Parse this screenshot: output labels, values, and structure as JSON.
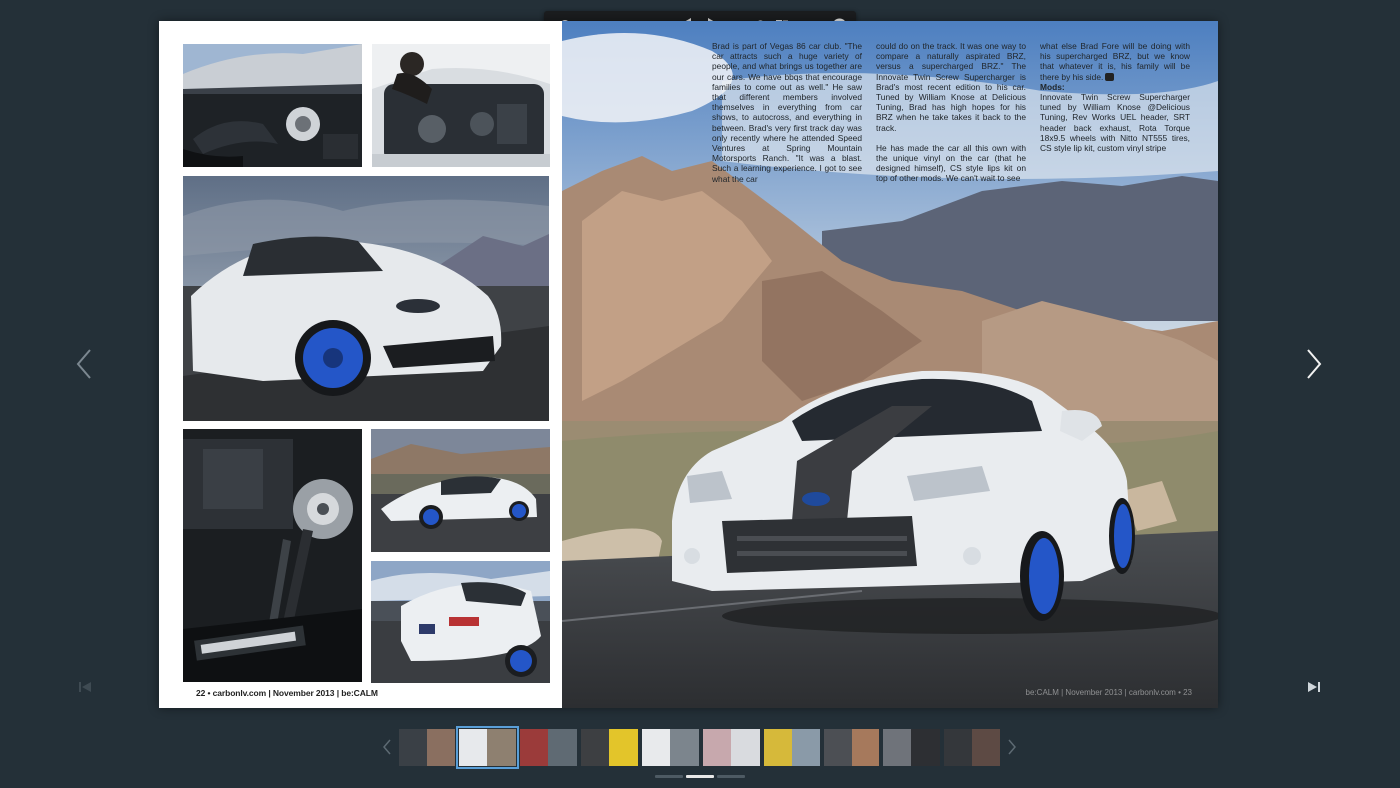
{
  "toolbar": {
    "zoom_level": 0.15,
    "icons": [
      "zoom-slider",
      "two-page-view-icon",
      "previous-page-icon",
      "next-page-icon",
      "search-icon",
      "bookmark-icon",
      "share-icon",
      "close-icon"
    ]
  },
  "left_page": {
    "footer": "22 • carbonlv.com | November 2013 | be:CALM"
  },
  "right_page": {
    "footer": "be:CALM | November 2013 | carbonlv.com • 23",
    "column1": {
      "p1": "Brad is part of Vegas 86 car club. \"The car attracts such a huge variety of people, and what brings us together are our cars. We have bbqs that encourage families to come out as well.\" He saw that different members involved themselves in everything from car shows, to autocross, and everything in between. Brad's very first track day was only recently where he attended Speed Ventures at Spring Mountain Motorsports Ranch. \"It was a blast. Such a learning experience. I got to see what the car"
    },
    "column2": {
      "p1": "could do on the track. It was one way to compare a naturally aspirated BRZ, versus a supercharged BRZ.\" The Innovate Twin Screw Supercharger is Brad's most recent edition to his car. Tuned by William Knose at Delicious Tuning, Brad has high hopes for his BRZ when he take takes it back to the track.",
      "p2": "He has made the car all this own with the unique vinyl on the car (that he designed himself), CS style lips kit on top of other mods. We can't wait to see"
    },
    "column3": {
      "p1": "what else Brad Fore will be doing with his supercharged BRZ, but we know that whatever it is, his family will be there by his side.",
      "mods_heading": "Mods:",
      "mods_text": "Innovate Twin Screw Supercharger tuned by William Knose @Delicious Tuning, Rev Works UEL header, SRT header back exhaust, Rota Torque 18x9.5 wheels with Nitto NT555 tires, CS style lip kit, custom vinyl stripe"
    }
  },
  "thumbnails": {
    "count": 10,
    "active_index": 1
  },
  "pager": {
    "pages": 3,
    "active_index": 1
  },
  "colors": {
    "background": "#243038",
    "toolbar": "#1b1d1f",
    "active_thumb_outline": "#5a9fd8",
    "wheel_blue": "#2456c8",
    "car_white": "#e9ecef"
  }
}
